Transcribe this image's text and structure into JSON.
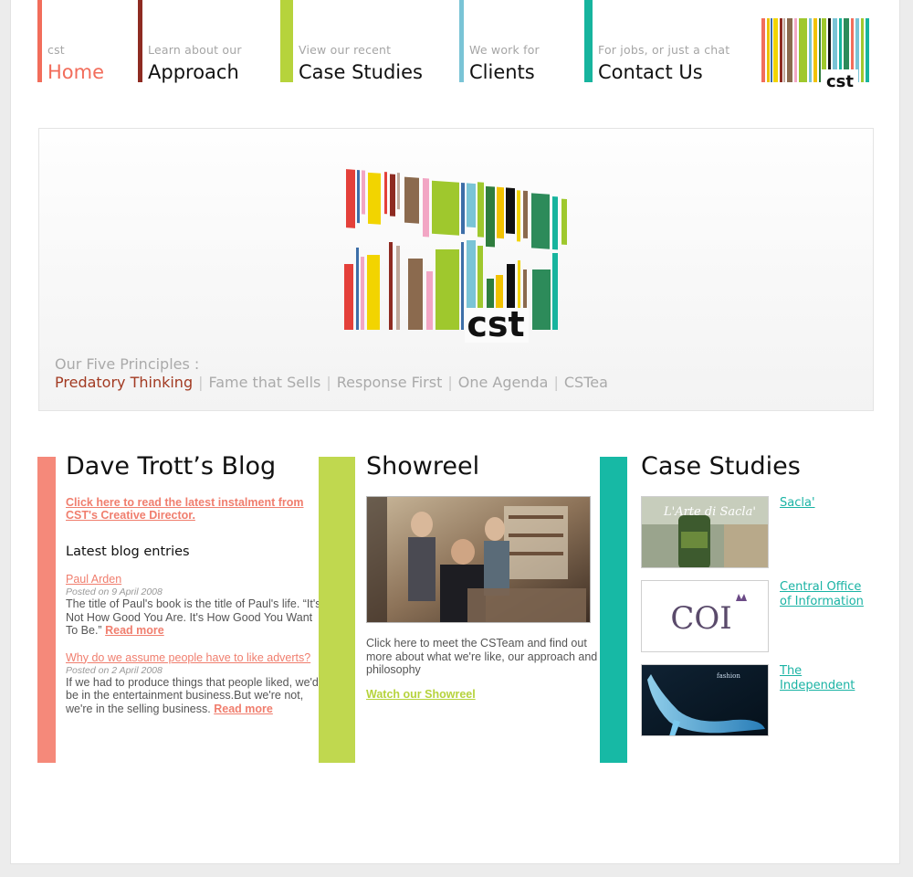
{
  "nav": [
    {
      "sub": "cst",
      "main": "Home",
      "color": "#f26d5b"
    },
    {
      "sub": "Learn about our",
      "main": "Approach",
      "color": "#8e2b22"
    },
    {
      "sub": "View our recent",
      "main": "Case Studies",
      "color": "#b6d33c"
    },
    {
      "sub": "We work for",
      "main": "Clients",
      "color": "#7ac4d6"
    },
    {
      "sub": "For jobs, or just a chat",
      "main": "Contact Us",
      "color": "#17b49e"
    }
  ],
  "logo": {
    "text": "cst"
  },
  "hero": {
    "principles_label": "Our Five Principles :",
    "principles": [
      "Predatory Thinking",
      "Fame that Sells",
      "Response First",
      "One Agenda",
      "CSTea"
    ]
  },
  "blog": {
    "title": "Dave Trott’s Blog",
    "lead_link": "Click here to read the latest instalment from CST's Creative Director.",
    "latest_heading": "Latest blog entries",
    "entries": [
      {
        "title": "Paul Arden",
        "posted": "Posted on 9 April 2008",
        "text": "The title of Paul's book is the title of Paul's life. “It's Not How Good You Are. It's How Good You Want To Be.”",
        "more": "Read more"
      },
      {
        "title": "Why do we assume people have to like adverts?",
        "posted": "Posted on 2 April 2008",
        "text": "If we had to produce things that people liked, we'd be in the entertainment business.But we're not, we're in the selling business.",
        "more": "Read more"
      }
    ]
  },
  "showreel": {
    "title": "Showreel",
    "text": "Click here to meet the CSTeam and find out more about what we're like, our approach and philosophy",
    "link": "Watch our Showreel"
  },
  "case_studies": {
    "title": "Case Studies",
    "items": [
      {
        "label": "Sacla'",
        "thumb_text": "L'Arte di Sacla'"
      },
      {
        "label": "Central Office of Information",
        "thumb_text": "COI"
      },
      {
        "label": "The Independent",
        "thumb_text": "fashion"
      }
    ]
  },
  "colors": {
    "pink": "#f5897a",
    "green": "#c0d84f",
    "teal": "#17b9a5",
    "maroon": "#a23a22"
  }
}
